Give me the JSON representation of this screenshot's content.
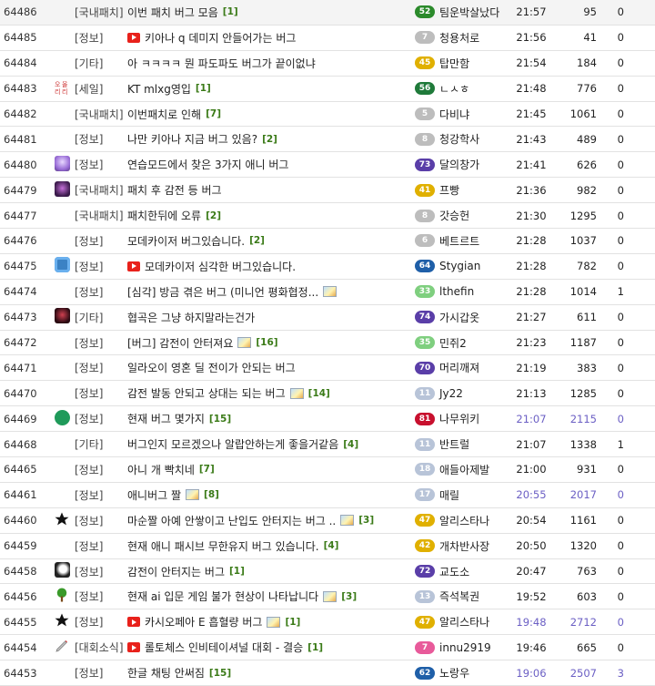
{
  "rows": [
    {
      "num": "64486",
      "icon": "none",
      "cat": "[국내패치]",
      "yt": false,
      "title": "이번 패치 버그 모음",
      "img": false,
      "cmt": "[1]",
      "lvl": "52",
      "lvlColor": "#2b8a2b",
      "author": "팀운박살났다",
      "time": "21:57",
      "views": "95",
      "likes": "0",
      "hot": false,
      "first": true
    },
    {
      "num": "64485",
      "icon": "none",
      "cat": "[정보]",
      "yt": true,
      "title": "키아나 q 데미지 안들어가는 버그",
      "img": false,
      "cmt": "",
      "lvl": "7",
      "lvlColor": "#bdbdbd",
      "author": "청용처로",
      "time": "21:56",
      "views": "41",
      "likes": "0",
      "hot": false
    },
    {
      "num": "64484",
      "icon": "none",
      "cat": "[기타]",
      "yt": false,
      "title": "아 ㅋㅋㅋㅋ 뭔 파도파도 버그가 끝이없냐",
      "img": false,
      "cmt": "",
      "lvl": "45",
      "lvlColor": "#e0b000",
      "author": "탑만함",
      "time": "21:54",
      "views": "184",
      "likes": "0",
      "hot": false
    },
    {
      "num": "64483",
      "icon": "oh-logo",
      "cat": "[세일]",
      "yt": false,
      "title": "KT mlxg영입",
      "img": false,
      "cmt": "[1]",
      "lvl": "56",
      "lvlColor": "#1f7a3a",
      "author": "ㄴㅅㅎ",
      "time": "21:48",
      "views": "776",
      "likes": "0",
      "hot": false
    },
    {
      "num": "64482",
      "icon": "none",
      "cat": "[국내패치]",
      "yt": false,
      "title": "이번패치로 인해",
      "img": false,
      "cmt": "[7]",
      "lvl": "5",
      "lvlColor": "#bdbdbd",
      "author": "다비냐",
      "time": "21:45",
      "views": "1061",
      "likes": "0",
      "hot": false
    },
    {
      "num": "64481",
      "icon": "none",
      "cat": "[정보]",
      "yt": false,
      "title": "나만 키아나 지금 버그 있음?",
      "img": false,
      "cmt": "[2]",
      "lvl": "8",
      "lvlColor": "#bdbdbd",
      "author": "청강학사",
      "time": "21:43",
      "views": "489",
      "likes": "0",
      "hot": false
    },
    {
      "num": "64480",
      "icon": "av-purple",
      "cat": "[정보]",
      "yt": false,
      "title": "연습모드에서 찾은 3가지 애니 버그",
      "img": false,
      "cmt": "",
      "lvl": "73",
      "lvlColor": "#5a3ea8",
      "author": "달의창가",
      "time": "21:41",
      "views": "626",
      "likes": "0",
      "hot": false
    },
    {
      "num": "64479",
      "icon": "av-dark",
      "cat": "[국내패치]",
      "yt": false,
      "title": "패치 후 감전 등 버그",
      "img": false,
      "cmt": "",
      "lvl": "41",
      "lvlColor": "#e0b000",
      "author": "프빵",
      "time": "21:36",
      "views": "982",
      "likes": "0",
      "hot": false
    },
    {
      "num": "64477",
      "icon": "none",
      "cat": "[국내패치]",
      "yt": false,
      "title": "패치한뒤에 오류",
      "img": false,
      "cmt": "[2]",
      "lvl": "8",
      "lvlColor": "#bdbdbd",
      "author": "갓승헌",
      "time": "21:30",
      "views": "1295",
      "likes": "0",
      "hot": false
    },
    {
      "num": "64476",
      "icon": "none",
      "cat": "[정보]",
      "yt": false,
      "title": "모데카이저 버그있습니다.",
      "img": false,
      "cmt": "[2]",
      "lvl": "6",
      "lvlColor": "#bdbdbd",
      "author": "베트르트",
      "time": "21:28",
      "views": "1037",
      "likes": "0",
      "hot": false
    },
    {
      "num": "64475",
      "icon": "av-blue",
      "cat": "[정보]",
      "yt": true,
      "title": "모데카이저 심각한 버그있습니다.",
      "img": false,
      "cmt": "",
      "lvl": "64",
      "lvlColor": "#1f5fa8",
      "author": "Stygian",
      "time": "21:28",
      "views": "782",
      "likes": "0",
      "hot": false
    },
    {
      "num": "64474",
      "icon": "none",
      "cat": "[정보]",
      "yt": false,
      "title": "[심각] 방금 겪은 버그 (미니언 평화협정...",
      "img": true,
      "cmt": "",
      "lvl": "33",
      "lvlColor": "#7fcf7f",
      "author": "lthefin",
      "time": "21:28",
      "views": "1014",
      "likes": "1",
      "hot": false
    },
    {
      "num": "64473",
      "icon": "av-red",
      "cat": "[기타]",
      "yt": false,
      "title": "협곡은 그냥 하지말라는건가",
      "img": false,
      "cmt": "",
      "lvl": "74",
      "lvlColor": "#5a3ea8",
      "author": "가시갑옷",
      "time": "21:27",
      "views": "611",
      "likes": "0",
      "hot": false
    },
    {
      "num": "64472",
      "icon": "none",
      "cat": "[정보]",
      "yt": false,
      "title": "[버그] 감전이 안터져요",
      "img": true,
      "cmt": "[16]",
      "lvl": "35",
      "lvlColor": "#7fcf7f",
      "author": "민쥐2",
      "time": "21:23",
      "views": "1187",
      "likes": "0",
      "hot": false
    },
    {
      "num": "64471",
      "icon": "none",
      "cat": "[정보]",
      "yt": false,
      "title": "일라오이 영혼 딜 전이가 안되는 버그",
      "img": false,
      "cmt": "",
      "lvl": "70",
      "lvlColor": "#5a3ea8",
      "author": "머리깨져",
      "time": "21:19",
      "views": "383",
      "likes": "0",
      "hot": false
    },
    {
      "num": "64470",
      "icon": "none",
      "cat": "[정보]",
      "yt": false,
      "title": "감전 발동 안되고 상대는 되는 버그",
      "img": true,
      "cmt": "[14]",
      "lvl": "11",
      "lvlColor": "#b8c4d8",
      "author": "Jy22",
      "time": "21:13",
      "views": "1285",
      "likes": "0",
      "hot": false
    },
    {
      "num": "64469",
      "icon": "av-green",
      "cat": "[정보]",
      "yt": false,
      "title": "현재 버그 몇가지",
      "img": false,
      "cmt": "[15]",
      "lvl": "81",
      "lvlColor": "#c8102e",
      "author": "나무위키",
      "time": "21:07",
      "views": "2115",
      "likes": "0",
      "hot": true
    },
    {
      "num": "64468",
      "icon": "none",
      "cat": "[기타]",
      "yt": false,
      "title": "버그인지 모르겠으나 알랍안하는게 좋을거같음",
      "img": false,
      "cmt": "[4]",
      "lvl": "11",
      "lvlColor": "#b8c4d8",
      "author": "반트럴",
      "time": "21:07",
      "views": "1338",
      "likes": "1",
      "hot": false
    },
    {
      "num": "64465",
      "icon": "none",
      "cat": "[정보]",
      "yt": false,
      "title": "아니 개 빡치네",
      "img": false,
      "cmt": "[7]",
      "lvl": "18",
      "lvlColor": "#b8c4d8",
      "author": "애들아제발",
      "time": "21:00",
      "views": "931",
      "likes": "0",
      "hot": false
    },
    {
      "num": "64461",
      "icon": "none",
      "cat": "[정보]",
      "yt": false,
      "title": "애니버그 짤",
      "img": true,
      "cmt": "[8]",
      "lvl": "17",
      "lvlColor": "#b8c4d8",
      "author": "매릴",
      "time": "20:55",
      "views": "2017",
      "likes": "0",
      "hot": true
    },
    {
      "num": "64460",
      "icon": "star",
      "cat": "[정보]",
      "yt": false,
      "title": "마순짤 아예 안쌓이고 난입도 안터지는 버그 ..",
      "img": true,
      "cmt": "[3]",
      "lvl": "47",
      "lvlColor": "#e0b000",
      "author": "알리스타나",
      "time": "20:54",
      "views": "1161",
      "likes": "0",
      "hot": false
    },
    {
      "num": "64459",
      "icon": "none",
      "cat": "[정보]",
      "yt": false,
      "title": "현재 애니 패시브 무한유지 버그 있습니다.",
      "img": false,
      "cmt": "[4]",
      "lvl": "42",
      "lvlColor": "#e0b000",
      "author": "개차반사장",
      "time": "20:50",
      "views": "1320",
      "likes": "0",
      "hot": false
    },
    {
      "num": "64458",
      "icon": "av-bw",
      "cat": "[정보]",
      "yt": false,
      "title": "감전이 안터지는 버그",
      "img": false,
      "cmt": "[1]",
      "lvl": "72",
      "lvlColor": "#5a3ea8",
      "author": "교도소",
      "time": "20:47",
      "views": "763",
      "likes": "0",
      "hot": false
    },
    {
      "num": "64456",
      "icon": "tree",
      "cat": "[정보]",
      "yt": false,
      "title": "현재 ai 입문 게임 불가 현상이 나타납니다",
      "img": true,
      "cmt": "[3]",
      "lvl": "13",
      "lvlColor": "#b8c4d8",
      "author": "즉석복권",
      "time": "19:52",
      "views": "603",
      "likes": "0",
      "hot": false
    },
    {
      "num": "64455",
      "icon": "star",
      "cat": "[정보]",
      "yt": true,
      "title": "카시오페아 E 흡혈량 버그",
      "img": true,
      "cmt": "[1]",
      "lvl": "47",
      "lvlColor": "#e0b000",
      "author": "알리스타나",
      "time": "19:48",
      "views": "2712",
      "likes": "0",
      "hot": true
    },
    {
      "num": "64454",
      "icon": "pen",
      "cat": "[대회소식]",
      "yt": true,
      "title": "롤토체스 인비테이셔널 대회 - 결승",
      "img": false,
      "cmt": "[1]",
      "lvl": "7",
      "lvlColor": "#e85a9a",
      "author": "innu2919",
      "time": "19:46",
      "views": "665",
      "likes": "0",
      "hot": false
    },
    {
      "num": "64453",
      "icon": "none",
      "cat": "[정보]",
      "yt": false,
      "title": "한글 채팅 안써짐",
      "img": false,
      "cmt": "[15]",
      "lvl": "62",
      "lvlColor": "#1f5fa8",
      "author": "노랑우",
      "time": "19:06",
      "views": "2507",
      "likes": "3",
      "hot": true
    }
  ]
}
